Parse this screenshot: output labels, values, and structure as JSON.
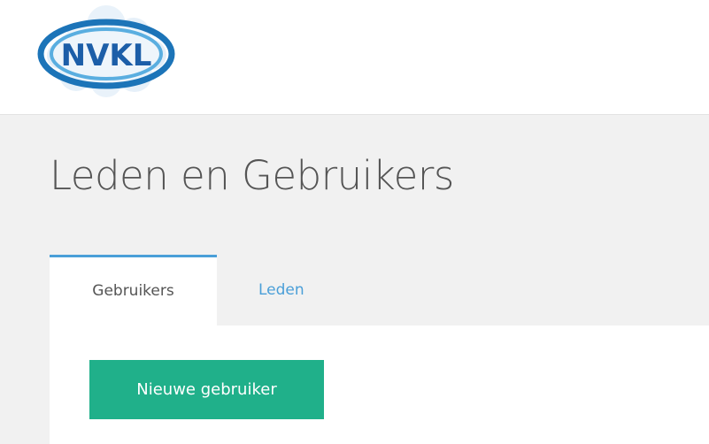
{
  "logo": {
    "text": "NVKL"
  },
  "page": {
    "title": "Leden en Gebruikers"
  },
  "tabs": [
    {
      "label": "Gebruikers",
      "active": true
    },
    {
      "label": "Leden",
      "active": false
    }
  ],
  "actions": {
    "new_user_label": "Nieuwe gebruiker"
  },
  "colors": {
    "accent_blue": "#4a9fd8",
    "button_green": "#20b08a",
    "content_background": "#f1f1f1",
    "title_text": "#555555"
  }
}
